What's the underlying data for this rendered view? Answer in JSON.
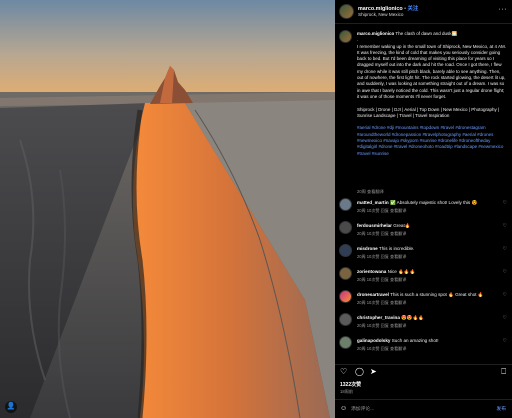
{
  "post": {
    "username": "marco.miglionico",
    "follow_label": "关注",
    "separator": "•",
    "location": "Shiprock, New Mexico",
    "more_label": "···"
  },
  "caption": {
    "username": "marco.miglionico",
    "text": " The clash of dawn and dusk🌅\n.\nI remember waking up in the small town of Shiprock, New Mexico, at 4 AM. It was freezing, the kind of cold that makes you seriously consider going back to bed. But I'd been dreaming of visiting this place for years so I dragged myself out into the dark and hit the road. Once I got there, I flew my drone while it was still pitch black, barely able to see anything. Then, out of nowhere, the first light hit. The rock started glowing, the desert lit up, and suddenly, I was looking at something straight out of a dream. I was so in awe that I barely noticed the cold. This wasn't just a regular drone flight; it was one of those moments I'll never forget.\n\nShiprock | Drone | DJI | Aerial | Top Down | New Mexico | Photography | Sunrise Landscape | Travel | Travel Inspiration\n\n",
    "hashtags": "#aerial #drone #dji #mountains #topdown #travel #dronestagram #aroundtheworld #dronepassion #travelphotography #aerial #drones #newmexico #navajo #skyporn #sunrise #dronelife #droneoftheday #digitalgirl #drone #travel #droneohoto #roadtrip #landscape #newmexico #travel #sunrise",
    "meta": "20周   查看翻译"
  },
  "comments": [
    {
      "user": "matted_martin",
      "text": "✅ Absolutely majestic shot! Lovely this 😍",
      "meta": "20周   10次赞   回复   查看翻译"
    },
    {
      "user": "ferdousmirhelar",
      "text": "Great🔥",
      "meta": "20周   10次赞   回复   查看翻译"
    },
    {
      "user": "misdrone",
      "text": "This is incredible.",
      "meta": "20周   10次赞   回复   查看翻译"
    },
    {
      "user": "zorientowana",
      "text": "Nice 🔥🔥🔥",
      "meta": "20周   10次赞   回复   查看翻译"
    },
    {
      "user": "dronesartravel",
      "text": "This is such a stunning spot 🔥 Great shot 🔥",
      "meta": "20周   10次赞   回复   查看翻译"
    },
    {
      "user": "christopher_travina",
      "text": "😍😍🔥🔥",
      "meta": "20周   10次赞   回复   查看翻译"
    },
    {
      "user": "galinapodolsky",
      "text": "Such an amazing shot!",
      "meta": "20周   10次赞   回复   查看翻译"
    }
  ],
  "actions": {
    "like_icon": "heart-icon",
    "comment_icon": "comment-icon",
    "share_icon": "share-icon",
    "save_icon": "bookmark-icon"
  },
  "likes": "1322次赞",
  "date": "18周前",
  "add_comment": {
    "placeholder": "添加评论...",
    "post_label": "发布"
  },
  "colors": {
    "background": "#000000",
    "link": "#6b9bff",
    "follow": "#4a8cff"
  }
}
